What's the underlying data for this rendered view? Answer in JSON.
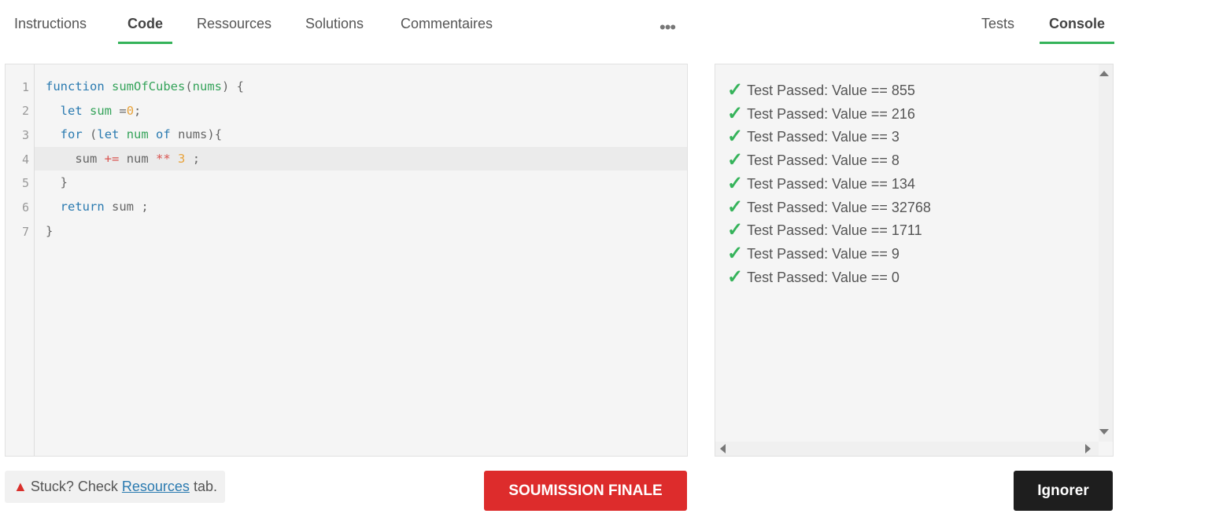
{
  "left_tabs": [
    {
      "label": "Instructions",
      "active": false
    },
    {
      "label": "Code",
      "active": true
    },
    {
      "label": "Ressources",
      "active": false
    },
    {
      "label": "Solutions",
      "active": false
    },
    {
      "label": "Commentaires",
      "active": false
    }
  ],
  "more_label": "•••",
  "right_tabs": [
    {
      "label": "Tests",
      "active": false
    },
    {
      "label": "Console",
      "active": true
    }
  ],
  "editor": {
    "line_numbers": [
      "1",
      "2",
      "3",
      "4",
      "5",
      "6",
      "7"
    ],
    "highlighted_line": 4
  },
  "console": {
    "check_glyph": "✓",
    "results": [
      "Test Passed: Value == 855",
      "Test Passed: Value == 216",
      "Test Passed: Value == 3",
      "Test Passed: Value == 8",
      "Test Passed: Value == 134",
      "Test Passed: Value == 32768",
      "Test Passed: Value == 1711",
      "Test Passed: Value == 9",
      "Test Passed: Value == 0"
    ]
  },
  "hint": {
    "prefix": "Stuck? Check ",
    "link": "Resources",
    "suffix": " tab."
  },
  "buttons": {
    "submit": "SOUMISSION FINALE",
    "ignore": "Ignorer"
  },
  "colors": {
    "accent_green": "#35b35a",
    "submit_red": "#dd2c2c",
    "ignore_dark": "#1e1e1e"
  }
}
